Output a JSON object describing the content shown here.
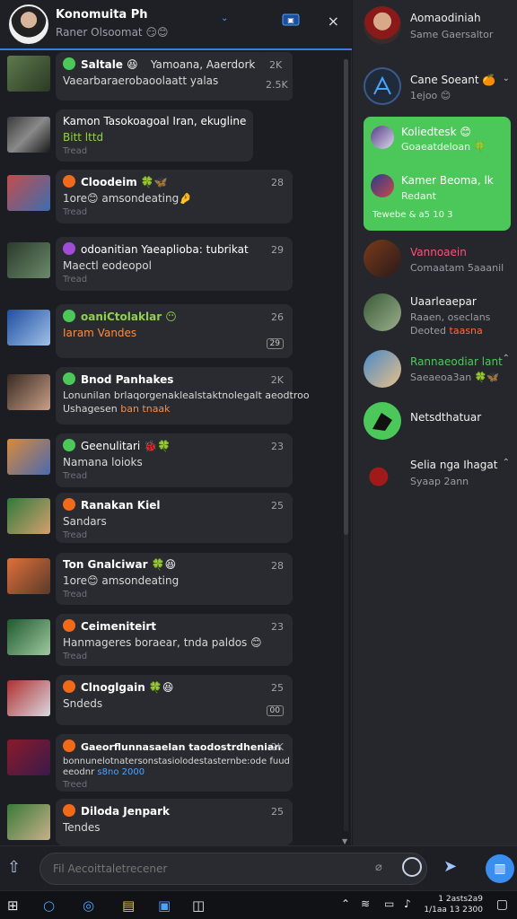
{
  "header": {
    "title": "Konomuita Ph",
    "subtitle": "Raner Olsoomat 😏😊",
    "close_label": "×"
  },
  "messages": [
    {
      "name": "Saltale 😆",
      "name_extra": "Yamoana, Aaerdork",
      "text": "Vaearbaraerobaoolaatt yalas",
      "meta": "",
      "count": "2K",
      "tag": "2.5K",
      "badge": "#4cc85a"
    },
    {
      "name": "Kamon Tasokoagoal Iran, ekugline",
      "name_extra": "",
      "text": "Bitt lttd",
      "meta": "Tread",
      "count": "",
      "tag": "",
      "badge": ""
    },
    {
      "name": "Cloodeim 🍀🦋",
      "name_extra": "",
      "text": "1ore😊 amsondeating🤌",
      "meta": "Tread",
      "count": "28",
      "tag": "",
      "badge": "#f06a1a"
    },
    {
      "name": "odoanitian Yaeaplioba:",
      "name_extra": "tubrikat",
      "text": "Maectl eodeopol",
      "meta": "Tread",
      "count": "29",
      "tag": "",
      "badge": "#a04cd8"
    },
    {
      "name": "oaniCtolaklar 😶",
      "name_extra": "",
      "text": "Iaram Vandes",
      "meta": "",
      "count": "26",
      "tag": "29",
      "badge": "#4cc85a"
    },
    {
      "name": "Bnod Panhakes",
      "name_extra": "",
      "text": "Lonunilan brlaqorgenaklealstaktnolegalt aeodtroo",
      "text2": "Ushagesen",
      "text2_hl": "ban tnaak",
      "meta": "",
      "count": "2K",
      "tag": "",
      "badge": "#4cc85a"
    },
    {
      "name": "Geenulitari 🐞🍀",
      "name_extra": "",
      "text": "Namana loioks",
      "meta": "Tread",
      "count": "23",
      "tag": "",
      "badge": "#4cc85a"
    },
    {
      "name": "Ranakan Kiel",
      "name_extra": "",
      "text": "Sandars",
      "meta": "Tread",
      "count": "25",
      "tag": "",
      "badge": "#f06a1a"
    },
    {
      "name": "Ton Gnalciwar 🍀😆",
      "name_extra": "",
      "text": "1ore😊 amsondeating",
      "meta": "Tread",
      "count": "28",
      "tag": "",
      "badge": ""
    },
    {
      "name": "Ceimeniteirt",
      "name_extra": "",
      "text": "Hanmageres boraear, tnda paldos 😊",
      "meta": "Tread",
      "count": "23",
      "tag": "",
      "badge": "#f06a1a"
    },
    {
      "name": "Clnoglgain 🍀😆",
      "name_extra": "",
      "text": "Sndeds",
      "meta": "",
      "count": "25",
      "tag": "00",
      "badge": "#f06a1a"
    },
    {
      "name": "Gaeorflunnasaelan taodostrdhenian",
      "name_extra": "",
      "text": "bonnunelotnatersonstasiolodestasternbe:ode fuud",
      "text2": "eeodnr",
      "text2_hl": "s8no 2000",
      "meta": "Treed",
      "count": "2K",
      "tag": "",
      "badge": "#f06a1a"
    },
    {
      "name": "Diloda Jenpark",
      "name_extra": "",
      "text": "Tendes",
      "meta": "",
      "count": "25",
      "tag": "",
      "badge": "#f06a1a"
    }
  ],
  "sidebar": {
    "top": {
      "name": "Aomaodiniah",
      "sub": "Same Gaersaltor"
    },
    "groups": [
      {
        "name": "Cane Soeant 🍊",
        "sub": "1ejoo 😊"
      }
    ],
    "green": {
      "row1_name": "Koliedtesk 😊",
      "row1_sub": "Goaeatdeloan 🍀",
      "row2_name": "Kamer Beoma, lk",
      "row2_sub": "Redant",
      "foot": "Tewebe & a5 10 3"
    },
    "items": [
      {
        "name": "Vannoaein",
        "sub": "Comaatam 5aaanil",
        "name_color": "#ff4f7b"
      },
      {
        "name": "Uaarleaepar",
        "sub": "Raaen, oseclans",
        "sub2": "Deoted ",
        "sub2_hl": "taasna",
        "name_color": "#f0f0f0"
      },
      {
        "name": "Rannaeodiar lant",
        "sub": "Saeaeoa3an 🍀🦋",
        "name_color": "#4cc85a"
      },
      {
        "name": "Netsdthatuar",
        "sub": "",
        "name_color": "#f0f0f0"
      },
      {
        "name": "Selia nga Ihagat",
        "sub": "Syaap 2ann",
        "name_color": "#f0f0f0"
      }
    ]
  },
  "composer": {
    "placeholder": "Fil Aecoittaletrecener"
  },
  "taskbar": {
    "time": "1 2asts2a9",
    "date": "1/1aa 13 2300"
  },
  "colors": {
    "accent": "#3b7de0",
    "green": "#4cc85a",
    "bg": "#1c1d22"
  }
}
